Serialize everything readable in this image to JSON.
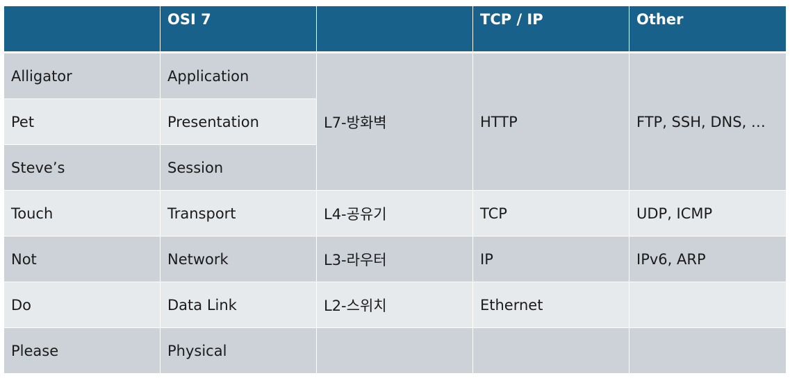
{
  "header": [
    "",
    "OSI 7",
    "",
    "TCP / IP",
    "Other"
  ],
  "mnemonic": [
    "Alligator",
    "Pet",
    "Steve’s",
    "Touch",
    "Not",
    "Do",
    "Please"
  ],
  "osi_layers": [
    "Application",
    "Presentation",
    "Session",
    "Transport",
    "Network",
    "Data Link",
    "Physical"
  ],
  "devices": {
    "l7": "L7-방화벽",
    "l4": "L4-공유기",
    "l3": "L3-라우터",
    "l2": "L2-스위치"
  },
  "tcpip": {
    "application": "HTTP",
    "transport": "TCP",
    "network": "IP",
    "link": "Ethernet"
  },
  "other": {
    "application": "FTP, SSH, DNS, …",
    "transport": "UDP, ICMP",
    "network": "IPv6, ARP"
  },
  "colors": {
    "header_bg": "#17618a",
    "row_dark": "#cdd1d8",
    "row_light": "#e7eaed"
  }
}
